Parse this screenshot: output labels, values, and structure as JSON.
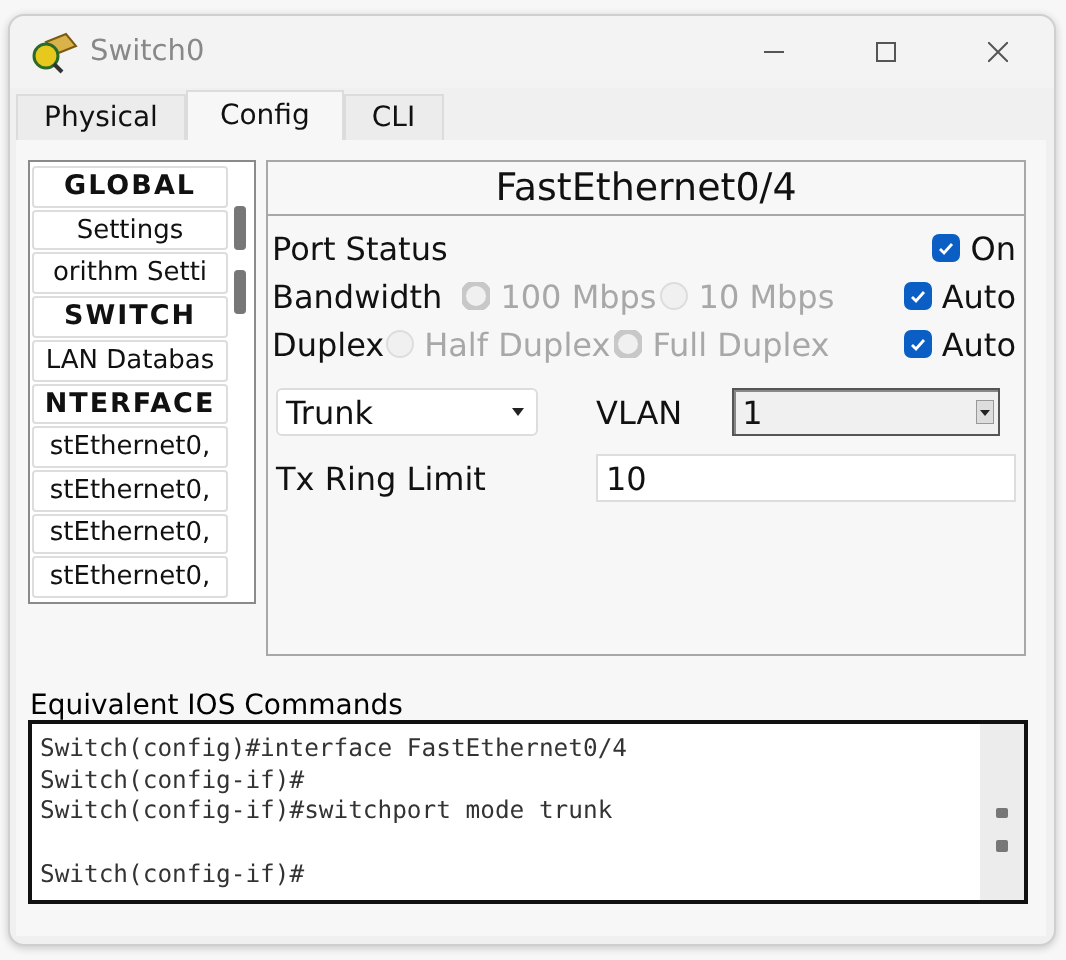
{
  "window": {
    "title": "Switch0"
  },
  "tabs": [
    {
      "label": "Physical",
      "selected": false
    },
    {
      "label": "Config",
      "selected": true
    },
    {
      "label": "CLI",
      "selected": false
    }
  ],
  "sidebar": {
    "items": [
      {
        "label": "GLOBAL",
        "kind": "header"
      },
      {
        "label": "Settings",
        "kind": "item"
      },
      {
        "label": "orithm Setti",
        "kind": "item"
      },
      {
        "label": "SWITCH",
        "kind": "header"
      },
      {
        "label": "LAN Databas",
        "kind": "item"
      },
      {
        "label": "NTERFACE",
        "kind": "header"
      },
      {
        "label": "stEthernet0,",
        "kind": "item"
      },
      {
        "label": "stEthernet0,",
        "kind": "item"
      },
      {
        "label": "stEthernet0,",
        "kind": "item"
      },
      {
        "label": "stEthernet0,",
        "kind": "item"
      }
    ]
  },
  "port": {
    "title": "FastEthernet0/4",
    "port_status": {
      "label": "Port Status",
      "option": {
        "label": "On",
        "checked": true
      }
    },
    "bandwidth": {
      "label": "Bandwidth",
      "options": [
        {
          "label": "100 Mbps",
          "selected": true,
          "disabled": true
        },
        {
          "label": "10 Mbps",
          "selected": false,
          "disabled": true
        }
      ],
      "auto": {
        "label": "Auto",
        "checked": true
      }
    },
    "duplex": {
      "label": "Duplex",
      "options": [
        {
          "label": "Half Duplex",
          "selected": false,
          "disabled": true
        },
        {
          "label": "Full Duplex",
          "selected": true,
          "disabled": true
        }
      ],
      "auto": {
        "label": "Auto",
        "checked": true
      }
    },
    "mode": {
      "value": "Trunk"
    },
    "vlan": {
      "label": "VLAN",
      "value": "1"
    },
    "tx_ring_limit": {
      "label": "Tx Ring Limit",
      "value": "10"
    }
  },
  "console": {
    "label": "Equivalent IOS Commands",
    "lines": [
      {
        "text": "Switch(config)#interface FastEthernet0/4",
        "blank_before": false
      },
      {
        "text": "Switch(config-if)#",
        "blank_before": false
      },
      {
        "text": "Switch(config-if)#switchport mode trunk",
        "blank_before": false
      },
      {
        "text": "Switch(config-if)#",
        "blank_before": true
      }
    ]
  }
}
